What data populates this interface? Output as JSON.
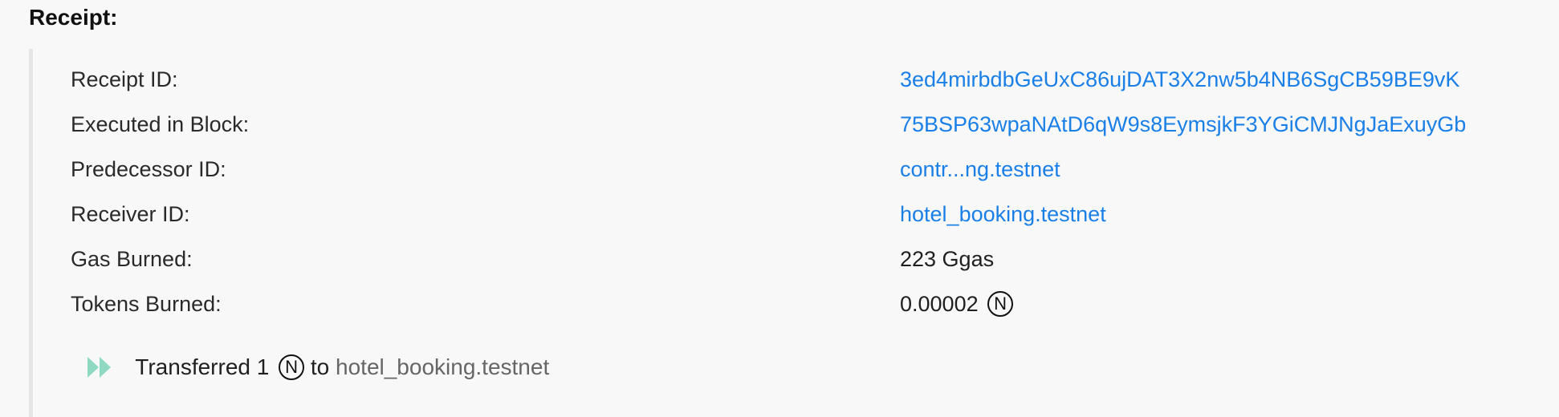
{
  "receipt": {
    "title": "Receipt:",
    "rows": [
      {
        "label": "Receipt ID:",
        "value": "3ed4mirbdbGeUxC86ujDAT3X2nw5b4NB6SgCB59BE9vK"
      },
      {
        "label": "Executed in Block:",
        "value": "75BSP63wpaNAtD6qW9s8EymsjkF3YGiCMJNgJaExuyGb"
      },
      {
        "label": "Predecessor ID:",
        "value": "contr...ng.testnet"
      },
      {
        "label": "Receiver ID:",
        "value": "hotel_booking.testnet"
      },
      {
        "label": "Gas Burned:",
        "value": "223 Ggas"
      },
      {
        "label": "Tokens Burned:",
        "value": "0.00002"
      }
    ],
    "near_symbol": "N",
    "action": {
      "prefix": "Transferred 1",
      "to_word": "to",
      "receiver": "hotel_booking.testnet"
    }
  },
  "colors": {
    "link": "#1a7fe6",
    "accent_arrows": "#8fd9c3",
    "panel_border": "#e5e5e5",
    "background": "#f8f8f8"
  },
  "icons": {
    "near_token": "near-token-icon",
    "action_arrows": "double-arrow-icon"
  }
}
